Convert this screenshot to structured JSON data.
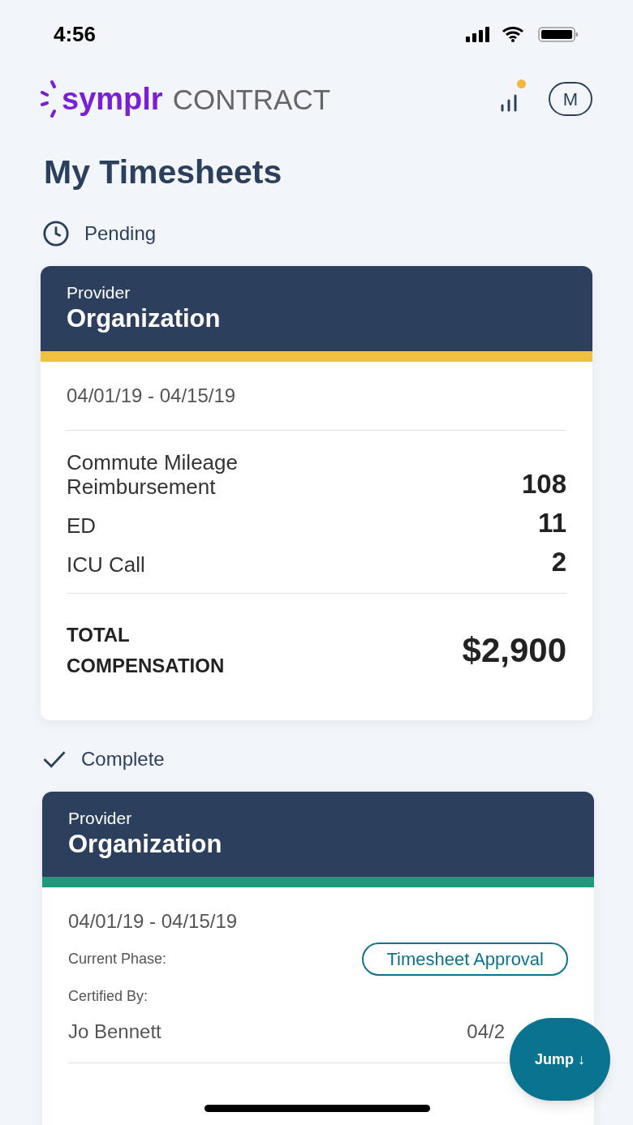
{
  "status_bar": {
    "time": "4:56"
  },
  "header": {
    "logo_brand": "symplr",
    "logo_product": "CONTRACT",
    "notification_dot": true,
    "avatar": "M"
  },
  "title": "My Timesheets",
  "sections": [
    {
      "kind": "pending",
      "label": "Pending",
      "card": {
        "kind": "summary",
        "subtitle": "Provider",
        "title": "Organization",
        "color": "#f0c040",
        "dates": "04/01/19 - 04/15/19",
        "items": [
          {
            "label": "Commute Mileage Reimbursement",
            "value": "108"
          },
          {
            "label": "ED",
            "value": "11"
          },
          {
            "label": "ICU Call",
            "value": "2"
          }
        ],
        "total_label": "TOTAL COMPENSATION",
        "total_value": "$2,900"
      }
    },
    {
      "kind": "complete",
      "label": "Complete",
      "card": {
        "kind": "phase",
        "subtitle": "Provider",
        "title": "Organization",
        "color": "#1e9b7d",
        "dates": "04/01/19 - 04/15/19",
        "phase_label": "Current Phase:",
        "phase": "Timesheet Approval",
        "certified_label": "Certified By:",
        "certified_name": "Jo Bennett",
        "certified_date": "04/2"
      }
    }
  ],
  "jump_button": "Jump ↓"
}
